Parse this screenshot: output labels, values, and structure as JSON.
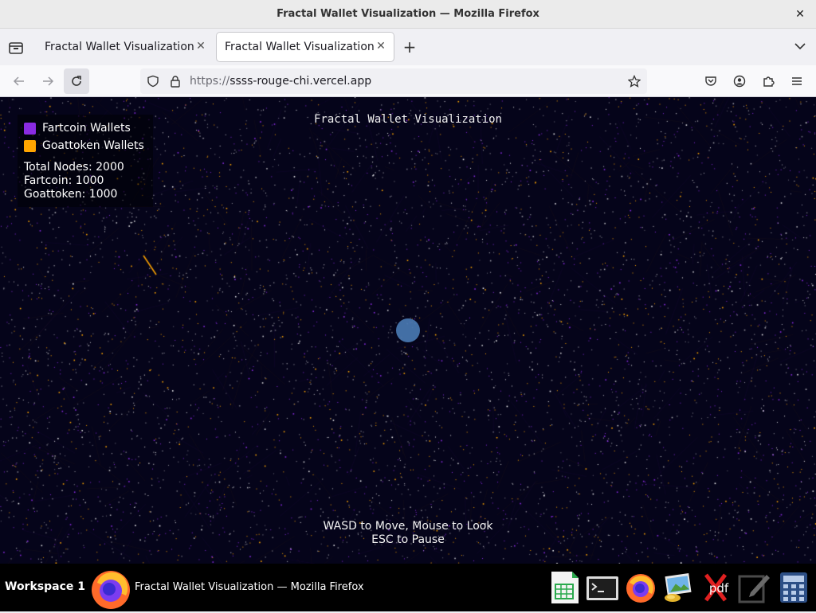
{
  "window": {
    "title": "Fractal Wallet Visualization — Mozilla Firefox"
  },
  "tabs": [
    {
      "label": "Fractal Wallet Visualization",
      "active": false
    },
    {
      "label": "Fractal Wallet Visualization",
      "active": true
    }
  ],
  "urlbar": {
    "protocol": "https://",
    "host": "ssss-rouge-chi.vercel.app"
  },
  "page": {
    "title": "Fractal Wallet Visualization",
    "legend": [
      {
        "label": "Fartcoin Wallets",
        "color": "#8a2be2"
      },
      {
        "label": "Goattoken Wallets",
        "color": "#ffa500"
      }
    ],
    "stats": {
      "total": "Total Nodes: 2000",
      "fartcoin": "Fartcoin: 1000",
      "goattoken": "Goattoken: 1000"
    },
    "hints": {
      "move": "WASD to Move, Mouse to Look",
      "pause": "ESC to Pause"
    },
    "background_color": "#05041a"
  },
  "taskbar": {
    "workspace": "Workspace 1",
    "active_window": "Fractal Wallet Visualization — Mozilla Firefox",
    "tray_icons": [
      "spreadsheet-icon",
      "terminal-icon",
      "firefox-icon",
      "image-viewer-icon",
      "pdf-icon",
      "text-editor-icon",
      "calculator-icon"
    ],
    "pdf_label": "pdf"
  }
}
